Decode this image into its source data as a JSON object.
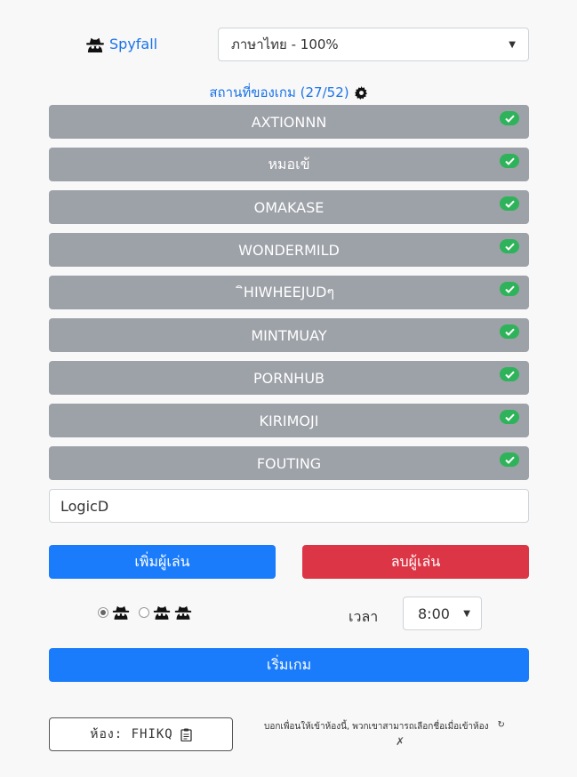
{
  "header": {
    "brand_label": "Spyfall",
    "language_selected": "ภาษาไทย - 100%"
  },
  "locations": {
    "link_label": "สถานที่ของเกม (27/52)"
  },
  "players": [
    {
      "name": "AXTIONNN"
    },
    {
      "name": "หมอเข้"
    },
    {
      "name": "OMAKASE"
    },
    {
      "name": "WONDERMILD"
    },
    {
      "name": "ิHIWHEEJUDๆ"
    },
    {
      "name": "MINTMUAY"
    },
    {
      "name": "PORNHUB"
    },
    {
      "name": "KIRIMOJI"
    },
    {
      "name": "FOUTING"
    }
  ],
  "name_input": {
    "value": "LogicD"
  },
  "buttons": {
    "add_player": "เพิ่มผู้เล่น",
    "remove_player": "ลบผู้เล่น",
    "start_game": "เริ่มเกม"
  },
  "spy_count": {
    "selected": 1,
    "options": [
      1,
      2
    ]
  },
  "timer": {
    "label": "เวลา",
    "selected": "8:00"
  },
  "room": {
    "label": "ห้อง: FHIKQ"
  },
  "share": {
    "note": "บอกเพื่อนให้เข้าห้องนี้, พวกเขาสามารถเลือกชื่อเมื่อเข้าห้อง",
    "refresh_icon": "↻",
    "close_icon": "✗"
  },
  "colors": {
    "primary": "#1a7cfa",
    "danger": "#dc3545",
    "player_bg": "#9da1a8",
    "check": "#2eb35a",
    "link": "#1a73e8"
  }
}
